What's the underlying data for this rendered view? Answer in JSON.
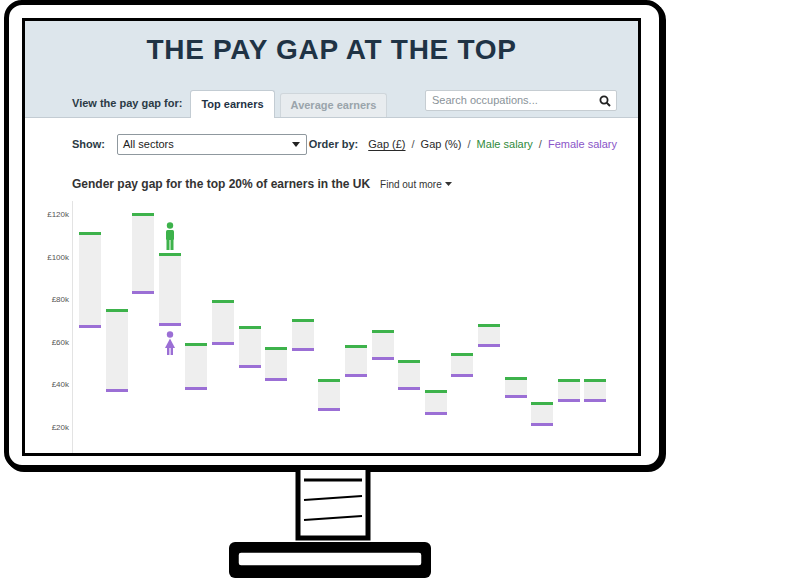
{
  "title": "THE PAY GAP AT THE TOP",
  "view_label": "View the pay gap for:",
  "tabs": [
    {
      "label": "Top earners",
      "selected": true
    },
    {
      "label": "Average earners",
      "selected": false
    }
  ],
  "search": {
    "placeholder": "Search occupations..."
  },
  "filter": {
    "label": "Show:",
    "value": "All sectors"
  },
  "order_by": {
    "label": "Order by:",
    "separator": "/",
    "options": [
      {
        "label": "Gap (£)",
        "selected": true,
        "color": "#2a2a2a"
      },
      {
        "label": "Gap (%)",
        "selected": false,
        "color": "#2a2a2a"
      },
      {
        "label": "Male salary",
        "selected": false,
        "color": "#2f8a3c"
      },
      {
        "label": "Female salary",
        "selected": false,
        "color": "#8a55c8"
      }
    ]
  },
  "chart": {
    "title": "Gender pay gap for the top 20% of earners in the UK",
    "more_link": "Find out more",
    "colors": {
      "male": "#3db24b",
      "female": "#9b6fd5"
    },
    "axis": {
      "ticks": [
        {
          "label": "£120k",
          "value": 120
        },
        {
          "label": "£100k",
          "value": 100
        },
        {
          "label": "£80k",
          "value": 80
        },
        {
          "label": "£60k",
          "value": 60
        },
        {
          "label": "£40k",
          "value": 40
        },
        {
          "label": "£20k",
          "value": 20
        }
      ]
    },
    "bars": [
      {
        "male": 112,
        "female": 67,
        "icons": false
      },
      {
        "male": 76,
        "female": 37,
        "icons": false
      },
      {
        "male": 121,
        "female": 83,
        "icons": false
      },
      {
        "male": 102,
        "female": 68,
        "icons": true
      },
      {
        "male": 60,
        "female": 38,
        "icons": false
      },
      {
        "male": 80,
        "female": 59,
        "icons": false
      },
      {
        "male": 68,
        "female": 48,
        "icons": false
      },
      {
        "male": 58,
        "female": 42,
        "icons": false
      },
      {
        "male": 71,
        "female": 56,
        "icons": false
      },
      {
        "male": 43,
        "female": 28,
        "icons": false
      },
      {
        "male": 59,
        "female": 44,
        "icons": false
      },
      {
        "male": 66,
        "female": 52,
        "icons": false
      },
      {
        "male": 52,
        "female": 38,
        "icons": false
      },
      {
        "male": 38,
        "female": 26,
        "icons": false
      },
      {
        "male": 55,
        "female": 44,
        "icons": false
      },
      {
        "male": 69,
        "female": 58,
        "icons": false
      },
      {
        "male": 44,
        "female": 34,
        "icons": false
      },
      {
        "male": 32,
        "female": 21,
        "icons": false
      },
      {
        "male": 43,
        "female": 32,
        "icons": false
      },
      {
        "male": 43,
        "female": 32,
        "icons": false
      }
    ]
  }
}
